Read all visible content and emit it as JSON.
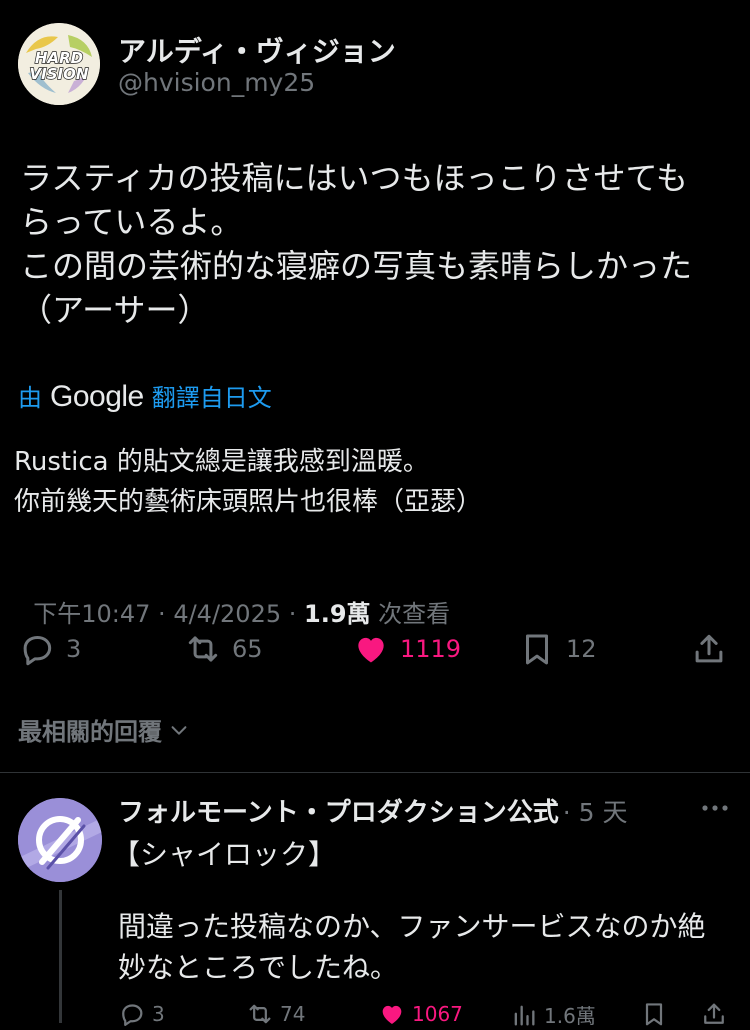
{
  "author": {
    "display_name": "アルディ・ヴィジョン",
    "handle": "@hvision_my25",
    "avatar_text": "HARD\nVISION"
  },
  "tweet": {
    "text_lines": [
      "ラスティカの投稿にはいつもほっこりさせても",
      "らっているよ。",
      "この間の芸術的な寝癖の写真も素晴らしかった",
      "（アーサー）"
    ],
    "translated_by_prefix": "由",
    "translated_by_brand": "Google",
    "translated_from": "翻譯自日文",
    "translation_lines": [
      "Rustica 的貼文總是讓我感到溫暖。",
      "你前幾天的藝術床頭照片也很棒（亞瑟）"
    ],
    "timestamp": "下午10:47 · 4/4/2025 · ",
    "views_count": "1.9萬",
    "views_label": " 次查看",
    "stats": {
      "replies": "3",
      "retweets": "65",
      "likes": "1119",
      "bookmarks": "12"
    }
  },
  "sort_label": "最相關的回覆",
  "reply": {
    "display_name": "フォルモーント・プロダクション公式",
    "time": "· 5 天",
    "tag_line": "【シャイロック】",
    "text_lines": [
      "間違った投稿なのか、ファンサービスなのか絶",
      "妙なところでしたね。"
    ],
    "stats": {
      "replies": "3",
      "retweets": "74",
      "likes": "1067",
      "views": "1.6萬"
    }
  },
  "colors": {
    "background": "#000000",
    "text": "#e7e9ea",
    "muted": "#71767b",
    "link": "#1d9bf0",
    "like": "#f91880"
  }
}
